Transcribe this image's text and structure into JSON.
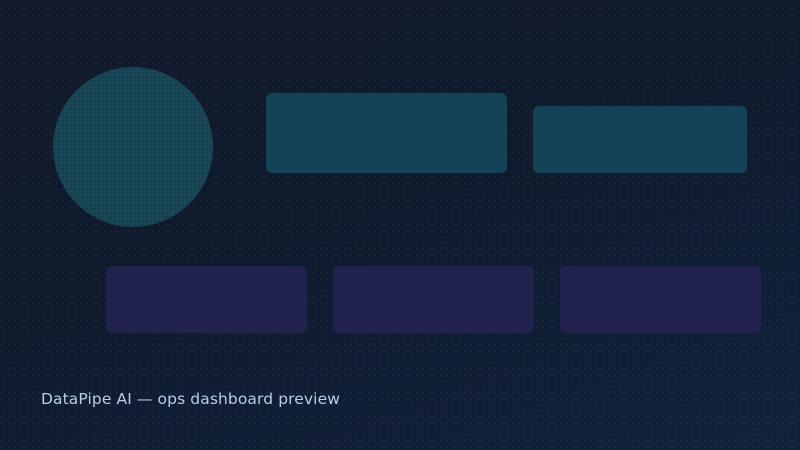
{
  "caption": "DataPipe AI — ops dashboard preview",
  "colors": {
    "background": "#111a2c",
    "circle": "#1a4758",
    "top_tiles": "#144257",
    "bottom_tiles": "#22224e",
    "caption_text": "#b9cee6"
  }
}
